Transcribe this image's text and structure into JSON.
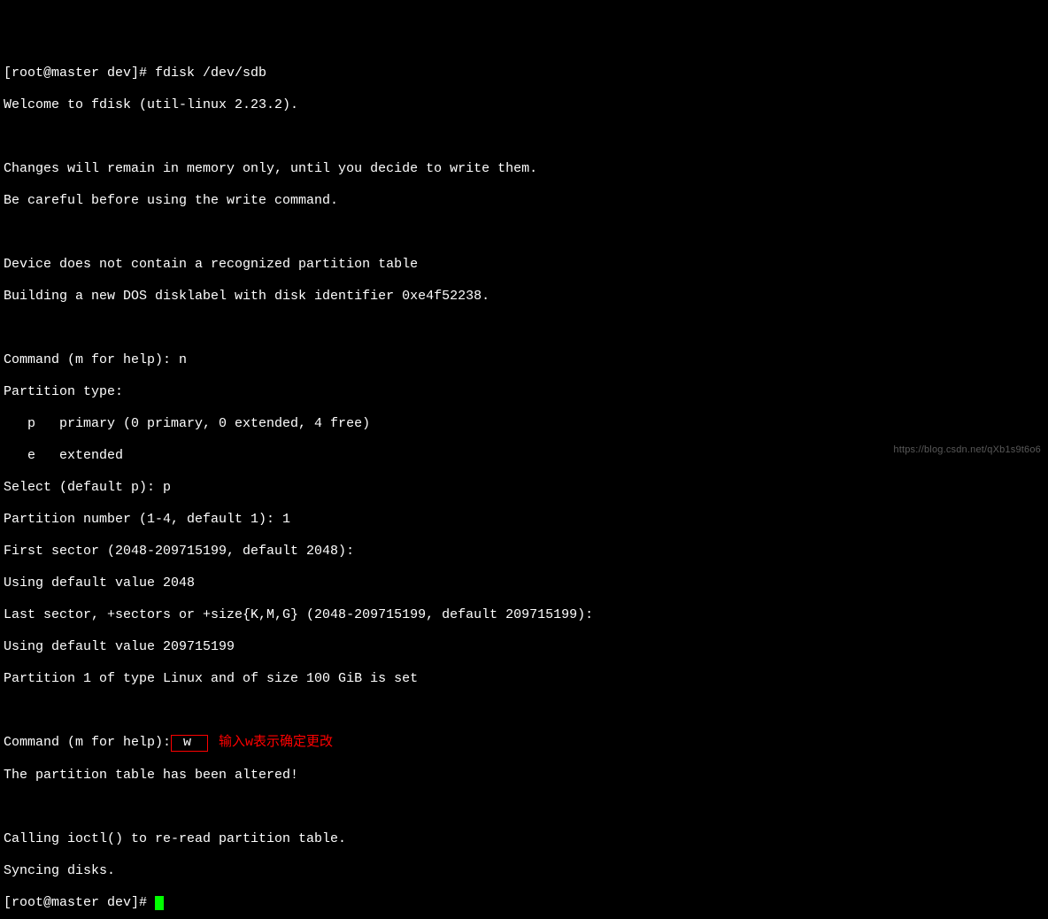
{
  "lines": {
    "l1": "[root@master dev]# fdisk /dev/sdb",
    "l2": "Welcome to fdisk (util-linux 2.23.2).",
    "l3": "",
    "l4": "Changes will remain in memory only, until you decide to write them.",
    "l5": "Be careful before using the write command.",
    "l6": "",
    "l7": "Device does not contain a recognized partition table",
    "l8": "Building a new DOS disklabel with disk identifier 0xe4f52238.",
    "l9": "",
    "l10": "Command (m for help): n",
    "l11": "Partition type:",
    "l12": "   p   primary (0 primary, 0 extended, 4 free)",
    "l13": "   e   extended",
    "l14": "Select (default p): p",
    "l15": "Partition number (1-4, default 1): 1",
    "l16": "First sector (2048-209715199, default 2048):",
    "l17": "Using default value 2048",
    "l18": "Last sector, +sectors or +size{K,M,G} (2048-209715199, default 209715199):",
    "l19": "Using default value 209715199",
    "l20": "Partition 1 of type Linux and of size 100 GiB is set",
    "l21": "",
    "l22a": "Command (m for help):",
    "l22b": " w",
    "l22c": "输入w表示确定更改",
    "l23": "The partition table has been altered!",
    "l24": "",
    "l25": "Calling ioctl() to re-read partition table.",
    "l26": "Syncing disks.",
    "l27": "[root@master dev]# "
  },
  "watermark": "https://blog.csdn.net/qXb1s9t6o6"
}
